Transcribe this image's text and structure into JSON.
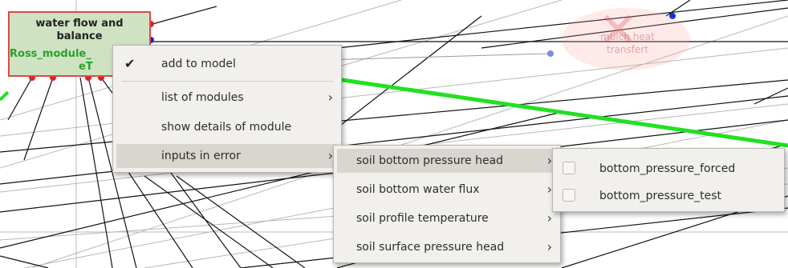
{
  "module": {
    "title_line1": "water flow and",
    "title_line2": "balance",
    "id_line1": "Ross_module_",
    "id_line2": "eT"
  },
  "ghost_module": {
    "line1": "mulch heat",
    "line2": "transfert"
  },
  "context_menu": {
    "add_to_model": "add to model",
    "add_to_model_checked": true,
    "list_of_modules": "list of modules",
    "show_details": "show details of module",
    "inputs_in_error": "inputs in error"
  },
  "inputs_submenu": {
    "items": [
      "soil bottom pressure head",
      "soil bottom water flux",
      "soil profile temperature",
      "soil surface pressure head"
    ]
  },
  "pressure_submenu": {
    "items": [
      "bottom_pressure_forced",
      "bottom_pressure_test"
    ]
  },
  "icons": {
    "check": "check-icon",
    "arrow": "chevron-right-icon"
  },
  "colors": {
    "connection_highlight": "#22e022",
    "module_border_error": "#e04848",
    "module_fill": "#cfe3c3",
    "port_red": "#e02020",
    "port_blue": "#2020d0"
  }
}
